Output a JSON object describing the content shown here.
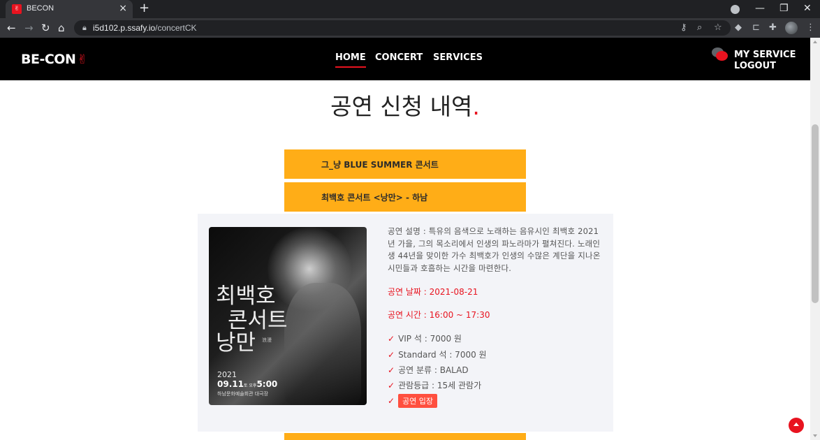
{
  "browser": {
    "tab_title": "BECON",
    "tab_favicon": "hand-icon",
    "url_host": "i5d102.p.ssafy.io",
    "url_path": "/concertCK",
    "icons": [
      "back-icon",
      "forward-icon",
      "reload-icon",
      "home-icon",
      "key-icon",
      "zoom-icon",
      "star-icon",
      "extensions-icon",
      "profile-icon",
      "menu-icon"
    ]
  },
  "header": {
    "logo": "BE-CON",
    "nav": [
      "HOME",
      "CONCERT",
      "SERVICES"
    ],
    "my_service": "MY SERVICE",
    "logout": "LOGOUT"
  },
  "page": {
    "title": "공연 신청 내역",
    "title_dot": "."
  },
  "concerts": [
    {
      "name": "그_냥 BLUE SUMMER 콘서트"
    },
    {
      "name": "최백호 콘서트 <낭만> - 하남"
    }
  ],
  "detail": {
    "poster": {
      "title_line1": "최백호",
      "title_line2": "콘서트",
      "title_line3": "낭만",
      "sub": "浪漫",
      "year": "2021",
      "date": "09.11",
      "day": "토 오후",
      "time": "5:00",
      "venue": "하남문화예술회관 대극장"
    },
    "description": "공연 설명 : 특유의 음색으로 노래하는 음유시인 최백호 2021년 가을, 그의 목소리에서 인생의 파노라마가 펼쳐진다. 노래인생 44년을 맞이한 가수 최백호가 인생의 수많은 계단을 지나온 시민들과 호흡하는 시간을 마련한다.",
    "date": "공연 날짜 : 2021-08-21",
    "time": "공연 시간 : 16:00 ~ 17:30",
    "items": [
      "VIP 석 : 7000 원",
      "Standard 석 : 7000 원",
      "공연 분류 : BALAD",
      "관람등급 : 15세 관람가"
    ],
    "enter_button": "공연 입장"
  },
  "colors": {
    "accent": "#e8131f",
    "bar": "#ffad17",
    "panel": "#f3f4f8",
    "button": "#ff4f3f"
  }
}
